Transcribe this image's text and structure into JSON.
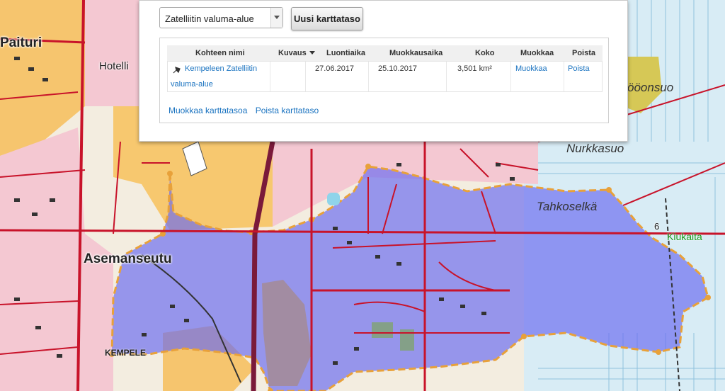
{
  "map": {
    "labels": {
      "paituri": "Paituri",
      "hotelli": "Hotelli",
      "asemanseutu": "Asemanseutu",
      "kempele": "KEMPELE",
      "nurkkasuo": "Nurkkasuo",
      "tahkoselka": "Tahkoselkä",
      "soonsuo": "ööonsuo",
      "kiukaita": "Kiukaita",
      "road_number": "6"
    },
    "colors": {
      "watershed_fill": "#6a6cf0",
      "watershed_outline": "#e8a13a",
      "residential": "#f5c9d2",
      "fields": "#f6c56e",
      "marsh": "#d7ebf4",
      "road_main": "#c8132a"
    }
  },
  "panel": {
    "layer_select": {
      "selected": "Zatelliitin valuma-alue"
    },
    "new_layer_button": "Uusi karttataso",
    "table": {
      "headers": {
        "name": "Kohteen nimi",
        "description": "Kuvaus",
        "created": "Luontiaika",
        "modified": "Muokkausaika",
        "size": "Koko",
        "edit": "Muokkaa",
        "delete": "Poista"
      },
      "row": {
        "name_line1": "Kempeleen Zatelliitin",
        "name_line2": "valuma-alue",
        "description": "",
        "created": "27.06.2017",
        "modified": "25.10.2017",
        "size": "3,501 km²",
        "edit": "Muokkaa",
        "delete": "Poista"
      }
    },
    "edit_layer_link": "Muokkaa karttatasoa",
    "delete_layer_link": "Poista karttataso"
  }
}
